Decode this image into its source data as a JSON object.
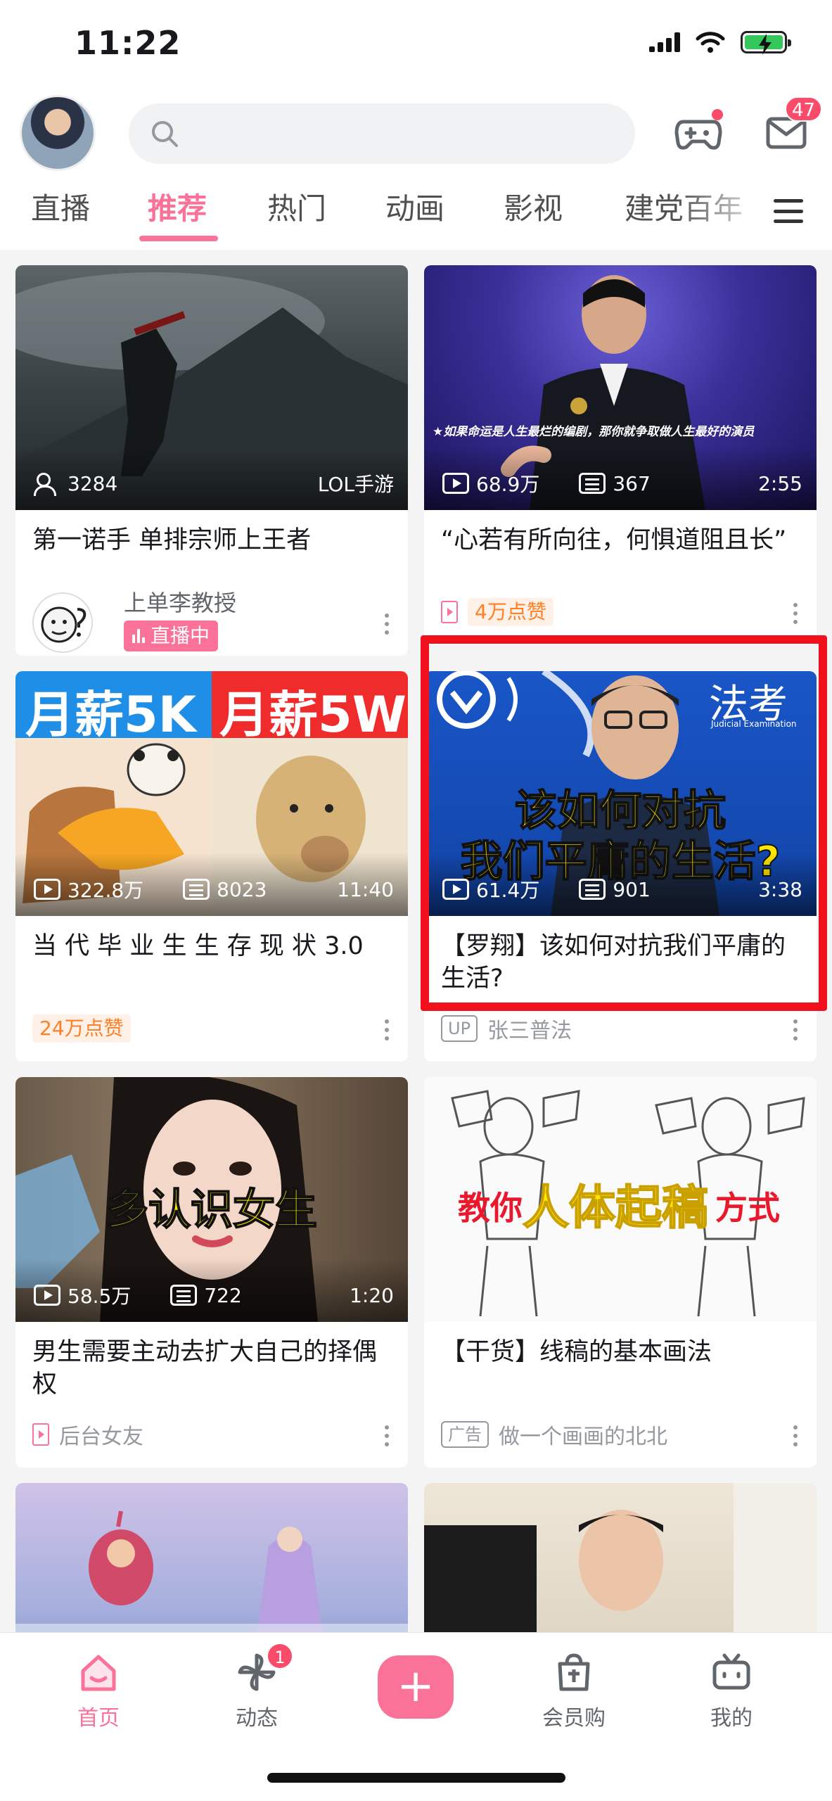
{
  "status_bar": {
    "time": "11:22"
  },
  "header": {
    "search_placeholder": "",
    "mail_badge": "47"
  },
  "tabs": [
    {
      "label": "直播"
    },
    {
      "label": "推荐"
    },
    {
      "label": "热门"
    },
    {
      "label": "动画"
    },
    {
      "label": "影视"
    },
    {
      "label": "建党百年"
    }
  ],
  "feed": [
    {
      "title": "第一诺手  单排宗师上王者",
      "viewers": "3284",
      "category": "LOL手游",
      "author": "上单李教授",
      "live_badge": "直播中"
    },
    {
      "title": "“心若有所向往，何惧道阻且长”",
      "views": "68.9万",
      "danmaku": "367",
      "duration": "2:55",
      "likes_tag": "4万点赞",
      "caption": "★如果命运是人生最烂的编剧，那你就争取做人生最好的演员"
    },
    {
      "title": "当 代 毕 业 生 生 存 现 状 3.0",
      "views": "322.8万",
      "danmaku": "8023",
      "duration": "11:40",
      "likes_tag": "24万点赞",
      "banner_left": "月薪5K",
      "banner_right": "月薪5W"
    },
    {
      "title": "【罗翔】该如何对抗我们平庸的生活?",
      "views": "61.4万",
      "danmaku": "901",
      "duration": "3:38",
      "author": "张三普法",
      "overlay_line1": "该如何对抗",
      "overlay_line2": "我们平庸的生活?",
      "logo_text": "法考",
      "logo_sub": "Judicial Examination"
    },
    {
      "title": "男生需要主动去扩大自己的择偶权",
      "views": "58.5万",
      "danmaku": "722",
      "duration": "1:20",
      "author": "后台女友",
      "overlay": "多认识女生"
    },
    {
      "title": "【干货】线稿的基本画法",
      "ad_tag": "广告",
      "author": "做一个画画的北北",
      "overlay_a": "教你",
      "overlay_b": "人体起稿",
      "overlay_c": "方式"
    }
  ],
  "bottom_nav": [
    {
      "label": "首页"
    },
    {
      "label": "动态",
      "badge": "1"
    },
    {
      "label": "+"
    },
    {
      "label": "会员购"
    },
    {
      "label": "我的"
    }
  ],
  "colors": {
    "accent": "#fb7299",
    "highlight": "#f0111c",
    "badge": "#fb4b6b"
  }
}
